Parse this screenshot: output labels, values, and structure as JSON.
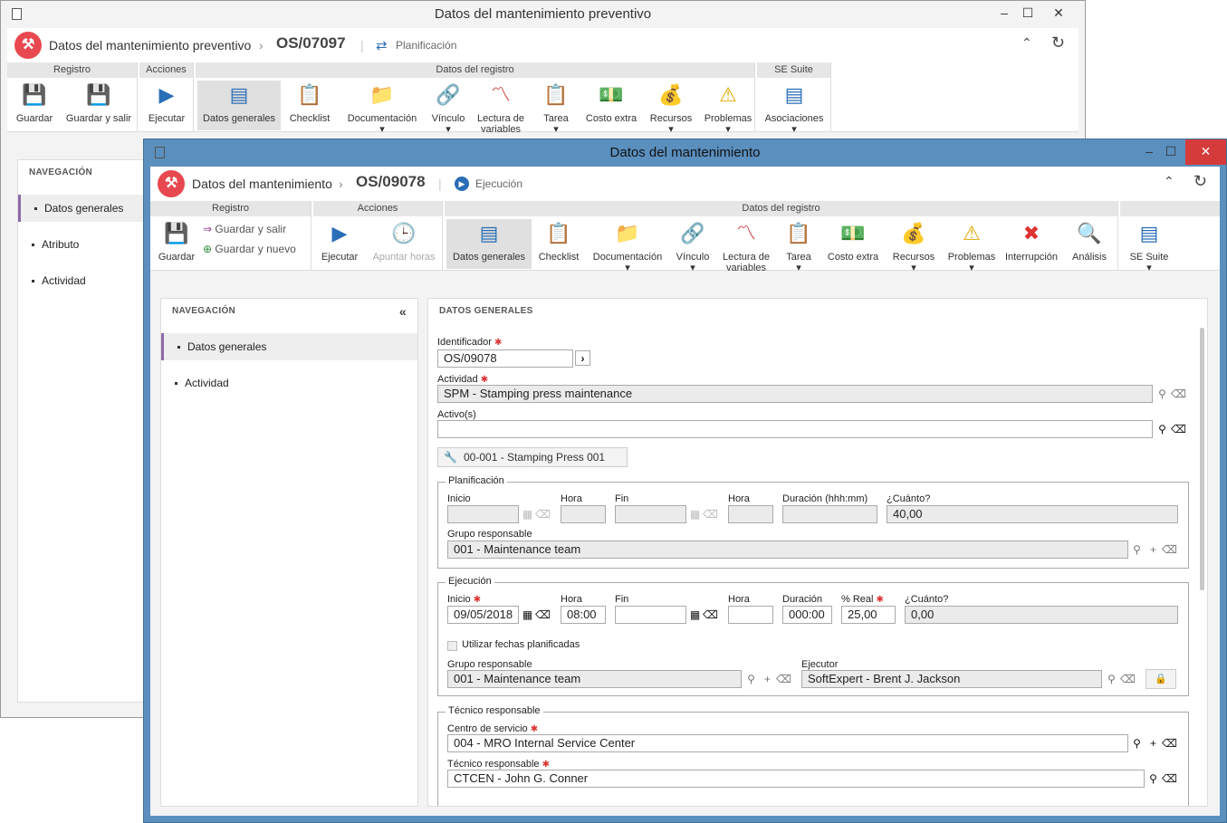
{
  "back": {
    "window_title": "Datos del mantenimiento preventivo",
    "app_title": "Datos del mantenimiento preventivo",
    "record_id": "OS/07097",
    "status": "Planificación",
    "groups": {
      "registro": "Registro",
      "acciones": "Acciones",
      "datos": "Datos del registro",
      "suite": "SE Suite"
    },
    "buttons": {
      "guardar": "Guardar",
      "guardar_salir": "Guardar y salir",
      "ejecutar": "Ejecutar",
      "datos_generales": "Datos generales",
      "checklist": "Checklist",
      "documentacion": "Documentación",
      "vinculo": "Vínculo",
      "lectura": "Lectura de variables",
      "tarea": "Tarea",
      "costo": "Costo extra",
      "recursos": "Recursos",
      "problemas": "Problemas",
      "asociaciones": "Asociaciones"
    },
    "nav_header": "NAVEGACIÓN",
    "nav": [
      "Datos generales",
      "Atributo",
      "Actividad"
    ]
  },
  "front": {
    "window_title": "Datos del mantenimiento",
    "app_title": "Datos del mantenimiento",
    "record_id": "OS/09078",
    "status": "Ejecución",
    "groups": {
      "registro": "Registro",
      "acciones": "Acciones",
      "datos": "Datos del registro"
    },
    "buttons": {
      "guardar": "Guardar",
      "guardar_salir": "Guardar y salir",
      "guardar_nuevo": "Guardar y nuevo",
      "ejecutar": "Ejecutar",
      "apuntar": "Apuntar horas",
      "datos_generales": "Datos generales",
      "checklist": "Checklist",
      "documentacion": "Documentación",
      "vinculo": "Vínculo",
      "lectura": "Lectura de variables",
      "tarea": "Tarea",
      "costo": "Costo extra",
      "recursos": "Recursos",
      "problemas": "Problemas",
      "interrupcion": "Interrupción",
      "analisis": "Análisis",
      "suite": "SE Suite"
    },
    "nav_header": "NAVEGACIÓN",
    "nav": [
      "Datos generales",
      "Actividad"
    ],
    "form_header": "DATOS GENERALES",
    "form": {
      "identificador_label": "Identificador",
      "identificador": "OS/09078",
      "actividad_label": "Actividad",
      "actividad": "SPM - Stamping press maintenance",
      "activos_label": "Activo(s)",
      "activos": "",
      "asset_chip": "00-001 - Stamping Press 001",
      "planificacion": {
        "legend": "Planificación",
        "inicio": "Inicio",
        "hora": "Hora",
        "fin": "Fin",
        "hora2": "Hora",
        "duracion": "Duración (hhh:mm)",
        "cuanto": "¿Cuánto?",
        "cuanto_val": "40,00",
        "grupo_label": "Grupo responsable",
        "grupo": "001 - Maintenance team"
      },
      "ejecucion": {
        "legend": "Ejecución",
        "inicio": "Inicio",
        "inicio_val": "09/05/2018",
        "hora": "Hora",
        "hora_val": "08:00",
        "fin": "Fin",
        "hora2": "Hora",
        "duracion": "Duración",
        "duracion_val": "000:00",
        "real": "% Real",
        "real_val": "25,00",
        "cuanto": "¿Cuánto?",
        "cuanto_val": "0,00",
        "utilizar": "Utilizar fechas planificadas",
        "grupo_label": "Grupo responsable",
        "grupo": "001 - Maintenance team",
        "ejecutor_label": "Ejecutor",
        "ejecutor": "SoftExpert - Brent J. Jackson"
      },
      "tecnico": {
        "legend": "Técnico responsable",
        "centro_label": "Centro de servicio",
        "centro": "004 - MRO Internal Service Center",
        "tecnico_label": "Técnico responsable",
        "tecnico": "CTCEN - John G. Conner"
      }
    }
  }
}
